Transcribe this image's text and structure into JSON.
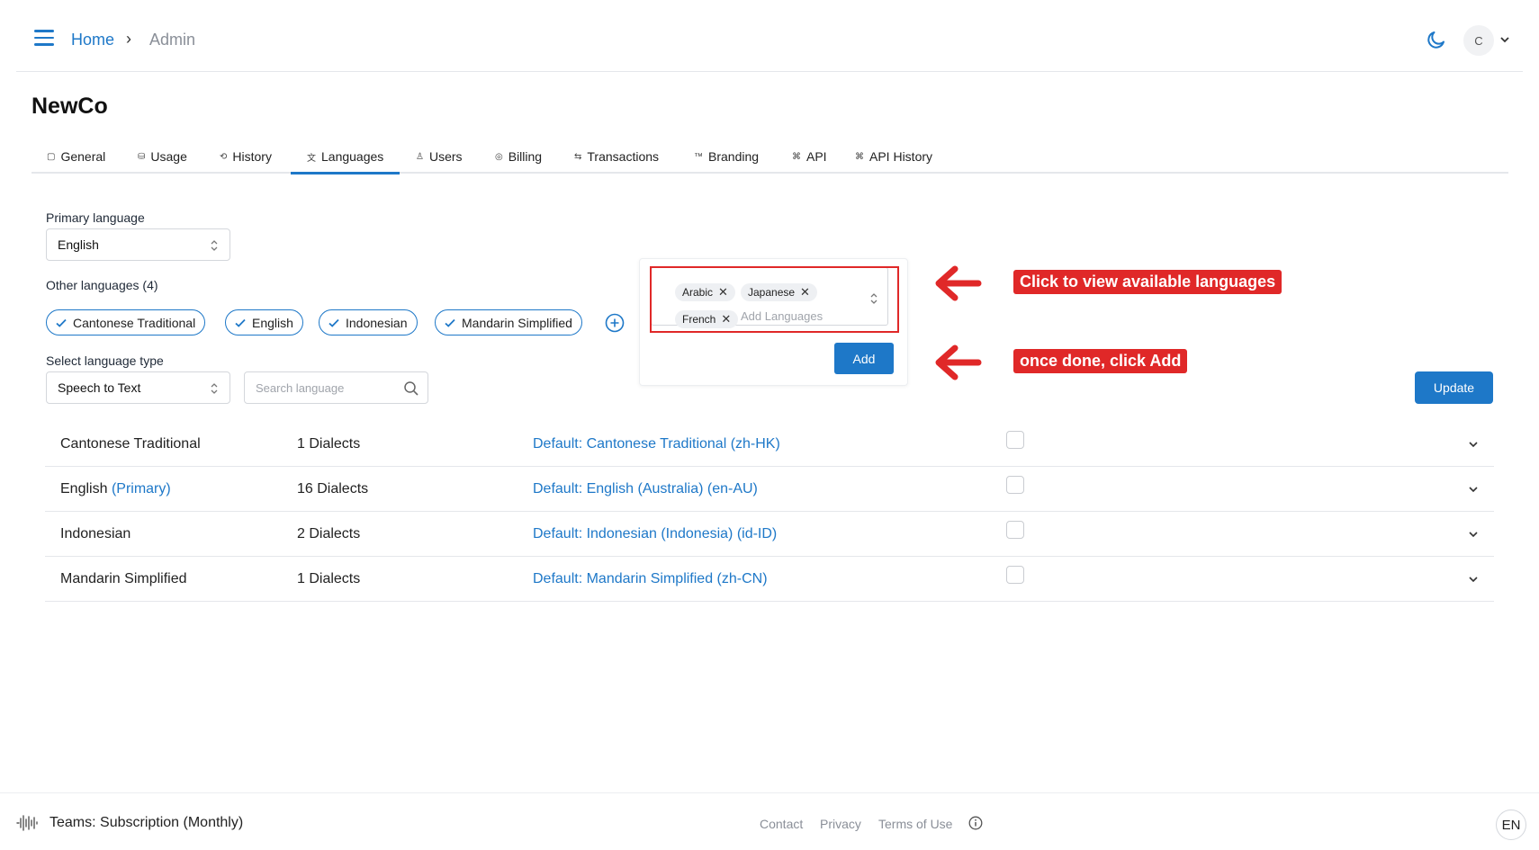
{
  "header": {
    "breadcrumb_home": "Home",
    "breadcrumb_separator": "›",
    "breadcrumb_current": "Admin",
    "avatar_initial": "C",
    "menu_icon": "hamburger-icon",
    "theme_icon": "moon-icon"
  },
  "org_name": "NewCo",
  "tabs": [
    {
      "label": "General",
      "icon": "square-icon"
    },
    {
      "label": "Usage",
      "icon": "cylinder-icon"
    },
    {
      "label": "History",
      "icon": "history-icon"
    },
    {
      "label": "Languages",
      "icon": "translate-icon",
      "active": true
    },
    {
      "label": "Users",
      "icon": "user-icon"
    },
    {
      "label": "Billing",
      "icon": "coins-icon"
    },
    {
      "label": "Transactions",
      "icon": "swap-icon"
    },
    {
      "label": "Branding",
      "icon": "trademark-icon"
    },
    {
      "label": "API",
      "icon": "api-icon"
    },
    {
      "label": "API History",
      "icon": "api-icon"
    }
  ],
  "primary_language": {
    "label": "Primary language",
    "value": "English"
  },
  "other_languages": {
    "label": "Other languages (4)",
    "chips": [
      "Cantonese Traditional",
      "English",
      "Indonesian",
      "Mandarin Simplified"
    ]
  },
  "language_type": {
    "label": "Select language type",
    "value": "Speech to Text"
  },
  "search": {
    "placeholder": "Search language"
  },
  "add_popup": {
    "tags": [
      "Arabic",
      "Japanese",
      "French"
    ],
    "remove_glyph": "✕",
    "input_placeholder": "Add Languages",
    "add_button": "Add"
  },
  "annotations": {
    "callout_1": "Click to view available languages",
    "callout_2": "once done, click Add",
    "accent_color": "#e02828"
  },
  "update_button": "Update",
  "table": {
    "rows": [
      {
        "name": "Cantonese Traditional",
        "primary": "",
        "dialects": "1 Dialects",
        "default": "Default: Cantonese Traditional (zh-HK)",
        "checked": false
      },
      {
        "name": "English",
        "primary": "(Primary)",
        "dialects": "16 Dialects",
        "default": "Default: English (Australia) (en-AU)",
        "checked": false
      },
      {
        "name": "Indonesian",
        "primary": "",
        "dialects": "2 Dialects",
        "default": "Default: Indonesian (Indonesia) (id-ID)",
        "checked": false
      },
      {
        "name": "Mandarin Simplified",
        "primary": "",
        "dialects": "1 Dialects",
        "default": "Default: Mandarin Simplified (zh-CN)",
        "checked": false
      }
    ]
  },
  "footer": {
    "plan": "Teams: Subscription (Monthly)",
    "links": [
      "Contact",
      "Privacy",
      "Terms of Use"
    ],
    "language": "EN"
  },
  "colors": {
    "brand_blue": "#1e78c8"
  }
}
